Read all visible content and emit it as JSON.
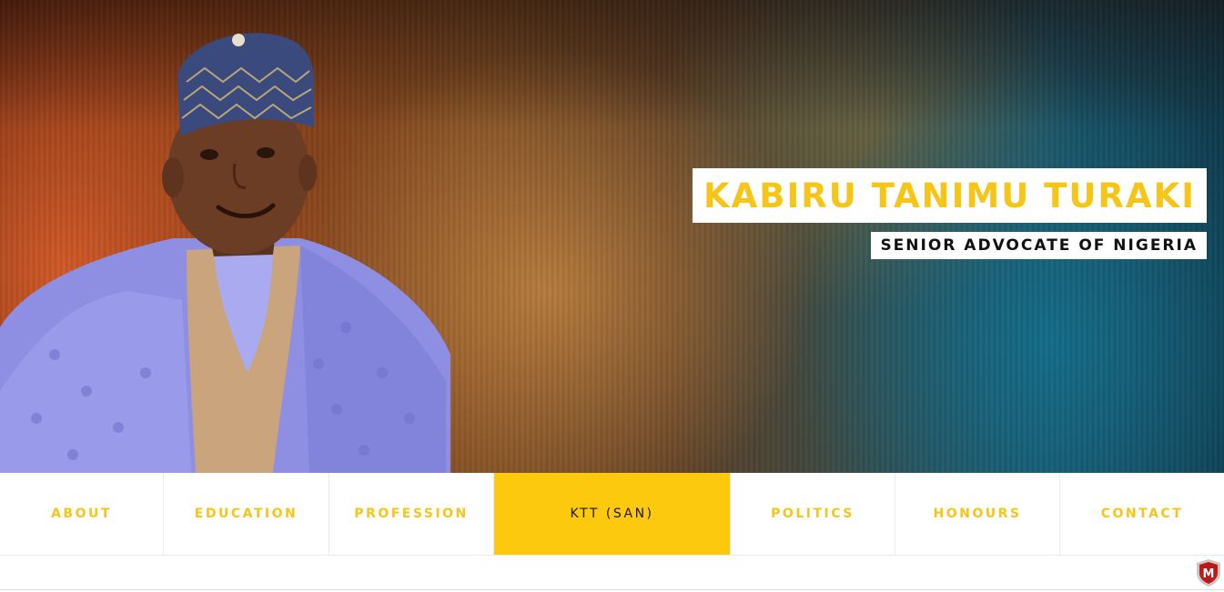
{
  "hero": {
    "name": "KABIRU TANIMU TURAKI",
    "subtitle": "SENIOR ADVOCATE OF NIGERIA",
    "portrait_icon": "person-portrait"
  },
  "nav": {
    "items": [
      {
        "label": "ABOUT",
        "active": false
      },
      {
        "label": "EDUCATION",
        "active": false
      },
      {
        "label": "PROFESSION",
        "active": false
      },
      {
        "label": "KTT (SAN)",
        "active": true
      },
      {
        "label": "POLITICS",
        "active": false
      },
      {
        "label": "HONOURS",
        "active": false
      },
      {
        "label": "CONTACT",
        "active": false
      }
    ]
  },
  "badge": {
    "icon": "mcafee-shield-icon",
    "letter": "M"
  },
  "colors": {
    "accent": "#fdc90f",
    "name_text": "#f5c518",
    "subtitle_text": "#111111"
  }
}
